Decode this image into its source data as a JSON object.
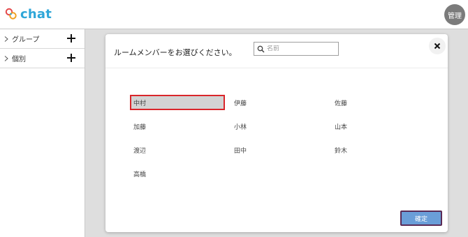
{
  "header": {
    "app_name": "chat",
    "admin_label": "管理",
    "brand_color": "#2ea6d8",
    "logo_color": "#e4484a"
  },
  "sidebar": {
    "items": [
      {
        "label": "グループ",
        "icon": "chevron-right-icon",
        "action_icon": "plus-icon"
      },
      {
        "label": "個別",
        "icon": "chevron-right-icon",
        "action_icon": "plus-icon"
      }
    ]
  },
  "modal": {
    "title": "ルームメンバーをお選びください。",
    "search": {
      "placeholder": "名前",
      "value": ""
    },
    "close_icon": "close-icon",
    "members": [
      {
        "name": "中村",
        "selected": true
      },
      {
        "name": "伊藤",
        "selected": false
      },
      {
        "name": "佐藤",
        "selected": false
      },
      {
        "name": "加藤",
        "selected": false
      },
      {
        "name": "小林",
        "selected": false
      },
      {
        "name": "山本",
        "selected": false
      },
      {
        "name": "渡辺",
        "selected": false
      },
      {
        "name": "田中",
        "selected": false
      },
      {
        "name": "鈴木",
        "selected": false
      },
      {
        "name": "高橋",
        "selected": false
      }
    ],
    "confirm_label": "確定",
    "selected_border_color": "#d9252a",
    "confirm_color": "#6a9ed8"
  }
}
